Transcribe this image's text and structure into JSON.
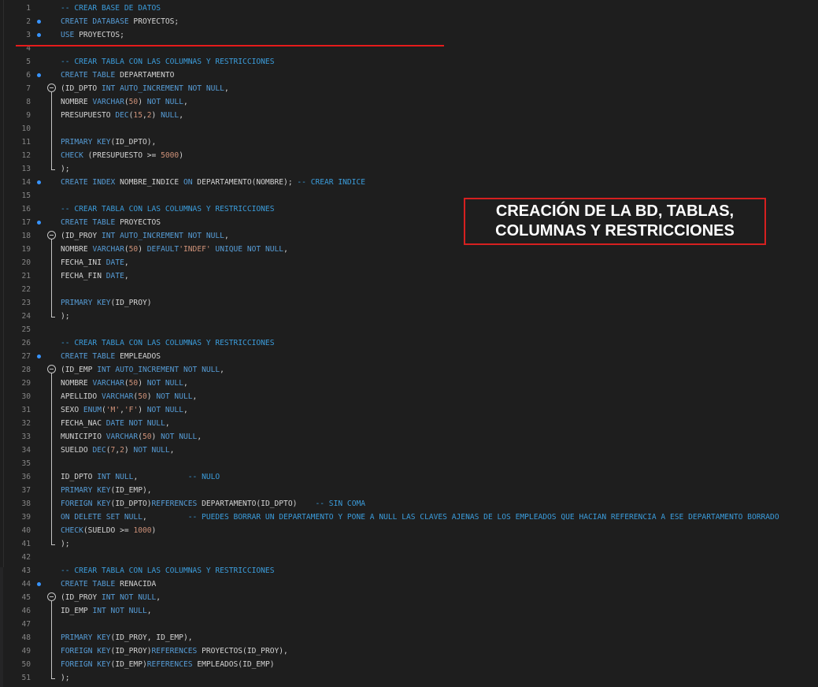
{
  "annotation": {
    "text": "CREACIÓN DE LA BD, TABLAS,\nCOLUMNAS Y RESTRICCIONES",
    "border_color": "#d62020",
    "text_color": "#ffffff"
  },
  "underline": {
    "color": "#e51b1b",
    "below_line": 3
  },
  "theme": {
    "background": "#1e1e1e",
    "keyword": "#569cd6",
    "identifier": "#d4d4d4",
    "number": "#ce9178",
    "comment": "#3b9cdb",
    "line_number": "#858585",
    "marker": "#3794ff"
  },
  "editor": {
    "lines": [
      {
        "n": "1",
        "tokens": [
          {
            "t": "com",
            "v": "-- CREAR BASE DE DATOS"
          }
        ]
      },
      {
        "n": "2",
        "marker": true,
        "tokens": [
          {
            "t": "kw",
            "v": "CREATE DATABASE "
          },
          {
            "t": "id",
            "v": "PROYECTOS;"
          }
        ]
      },
      {
        "n": "3",
        "marker": true,
        "tokens": [
          {
            "t": "kw",
            "v": "USE "
          },
          {
            "t": "id",
            "v": "PROYECTOS;"
          }
        ]
      },
      {
        "n": "4",
        "tokens": []
      },
      {
        "n": "5",
        "tokens": [
          {
            "t": "com",
            "v": "-- CREAR TABLA CON LAS COLUMNAS Y RESTRICCIONES"
          }
        ]
      },
      {
        "n": "6",
        "marker": true,
        "tokens": [
          {
            "t": "kw",
            "v": "CREATE TABLE "
          },
          {
            "t": "id",
            "v": "DEPARTAMENTO"
          }
        ]
      },
      {
        "n": "7",
        "fold": "start",
        "tokens": [
          {
            "t": "id",
            "v": "(ID_DPTO "
          },
          {
            "t": "kw",
            "v": "INT AUTO_INCREMENT NOT NULL"
          },
          {
            "t": "id",
            "v": ","
          }
        ]
      },
      {
        "n": "8",
        "fold": "mid",
        "tokens": [
          {
            "t": "id",
            "v": "NOMBRE "
          },
          {
            "t": "kw",
            "v": "VARCHAR"
          },
          {
            "t": "id",
            "v": "("
          },
          {
            "t": "num",
            "v": "50"
          },
          {
            "t": "id",
            "v": ") "
          },
          {
            "t": "kw",
            "v": "NOT NULL"
          },
          {
            "t": "id",
            "v": ","
          }
        ]
      },
      {
        "n": "9",
        "fold": "mid",
        "tokens": [
          {
            "t": "id",
            "v": "PRESUPUESTO "
          },
          {
            "t": "kw",
            "v": "DEC"
          },
          {
            "t": "id",
            "v": "("
          },
          {
            "t": "num",
            "v": "15"
          },
          {
            "t": "id",
            "v": ","
          },
          {
            "t": "num",
            "v": "2"
          },
          {
            "t": "id",
            "v": ") "
          },
          {
            "t": "kw",
            "v": "NULL"
          },
          {
            "t": "id",
            "v": ","
          }
        ]
      },
      {
        "n": "10",
        "fold": "mid",
        "tokens": []
      },
      {
        "n": "11",
        "fold": "mid",
        "tokens": [
          {
            "t": "kw",
            "v": "PRIMARY KEY"
          },
          {
            "t": "id",
            "v": "(ID_DPTO),"
          }
        ]
      },
      {
        "n": "12",
        "fold": "mid",
        "tokens": [
          {
            "t": "kw",
            "v": "CHECK "
          },
          {
            "t": "id",
            "v": "(PRESUPUESTO >= "
          },
          {
            "t": "num",
            "v": "5000"
          },
          {
            "t": "id",
            "v": ")"
          }
        ]
      },
      {
        "n": "13",
        "fold": "end",
        "tokens": [
          {
            "t": "id",
            "v": ");"
          }
        ]
      },
      {
        "n": "14",
        "marker": true,
        "tokens": [
          {
            "t": "kw",
            "v": "CREATE INDEX "
          },
          {
            "t": "id",
            "v": "NOMBRE_INDICE "
          },
          {
            "t": "kw",
            "v": "ON "
          },
          {
            "t": "id",
            "v": "DEPARTAMENTO(NOMBRE); "
          },
          {
            "t": "com",
            "v": "-- CREAR INDICE"
          }
        ]
      },
      {
        "n": "15",
        "tokens": []
      },
      {
        "n": "16",
        "tokens": [
          {
            "t": "com",
            "v": "-- CREAR TABLA CON LAS COLUMNAS Y RESTRICCIONES"
          }
        ]
      },
      {
        "n": "17",
        "marker": true,
        "tokens": [
          {
            "t": "kw",
            "v": "CREATE TABLE "
          },
          {
            "t": "id",
            "v": "PROYECTOS"
          }
        ]
      },
      {
        "n": "18",
        "fold": "start",
        "tokens": [
          {
            "t": "id",
            "v": "(ID_PROY "
          },
          {
            "t": "kw",
            "v": "INT AUTO_INCREMENT NOT NULL"
          },
          {
            "t": "id",
            "v": ","
          }
        ]
      },
      {
        "n": "19",
        "fold": "mid",
        "tokens": [
          {
            "t": "id",
            "v": "NOMBRE "
          },
          {
            "t": "kw",
            "v": "VARCHAR"
          },
          {
            "t": "id",
            "v": "("
          },
          {
            "t": "num",
            "v": "50"
          },
          {
            "t": "id",
            "v": ") "
          },
          {
            "t": "kw",
            "v": "DEFAULT"
          },
          {
            "t": "str",
            "v": "'INDEF'"
          },
          {
            "t": "kw",
            "v": " UNIQUE NOT NULL"
          },
          {
            "t": "id",
            "v": ","
          }
        ]
      },
      {
        "n": "20",
        "fold": "mid",
        "tokens": [
          {
            "t": "id",
            "v": "FECHA_INI "
          },
          {
            "t": "kw",
            "v": "DATE"
          },
          {
            "t": "id",
            "v": ","
          }
        ]
      },
      {
        "n": "21",
        "fold": "mid",
        "tokens": [
          {
            "t": "id",
            "v": "FECHA_FIN "
          },
          {
            "t": "kw",
            "v": "DATE"
          },
          {
            "t": "id",
            "v": ","
          }
        ]
      },
      {
        "n": "22",
        "fold": "mid",
        "tokens": []
      },
      {
        "n": "23",
        "fold": "mid",
        "tokens": [
          {
            "t": "kw",
            "v": "PRIMARY KEY"
          },
          {
            "t": "id",
            "v": "(ID_PROY)"
          }
        ]
      },
      {
        "n": "24",
        "fold": "end",
        "tokens": [
          {
            "t": "id",
            "v": ");"
          }
        ]
      },
      {
        "n": "25",
        "tokens": []
      },
      {
        "n": "26",
        "tokens": [
          {
            "t": "com",
            "v": "-- CREAR TABLA CON LAS COLUMNAS Y RESTRICCIONES"
          }
        ]
      },
      {
        "n": "27",
        "marker": true,
        "tokens": [
          {
            "t": "kw",
            "v": "CREATE TABLE "
          },
          {
            "t": "id",
            "v": "EMPLEADOS"
          }
        ]
      },
      {
        "n": "28",
        "fold": "start",
        "tokens": [
          {
            "t": "id",
            "v": "(ID_EMP "
          },
          {
            "t": "kw",
            "v": "INT AUTO_INCREMENT NOT NULL"
          },
          {
            "t": "id",
            "v": ","
          }
        ]
      },
      {
        "n": "29",
        "fold": "mid",
        "tokens": [
          {
            "t": "id",
            "v": "NOMBRE "
          },
          {
            "t": "kw",
            "v": "VARCHAR"
          },
          {
            "t": "id",
            "v": "("
          },
          {
            "t": "num",
            "v": "50"
          },
          {
            "t": "id",
            "v": ") "
          },
          {
            "t": "kw",
            "v": "NOT NULL"
          },
          {
            "t": "id",
            "v": ","
          }
        ]
      },
      {
        "n": "30",
        "fold": "mid",
        "tokens": [
          {
            "t": "id",
            "v": "APELLIDO "
          },
          {
            "t": "kw",
            "v": "VARCHAR"
          },
          {
            "t": "id",
            "v": "("
          },
          {
            "t": "num",
            "v": "50"
          },
          {
            "t": "id",
            "v": ") "
          },
          {
            "t": "kw",
            "v": "NOT NULL"
          },
          {
            "t": "id",
            "v": ","
          }
        ]
      },
      {
        "n": "31",
        "fold": "mid",
        "tokens": [
          {
            "t": "id",
            "v": "SEXO "
          },
          {
            "t": "kw",
            "v": "ENUM"
          },
          {
            "t": "id",
            "v": "("
          },
          {
            "t": "str",
            "v": "'M'"
          },
          {
            "t": "id",
            "v": ","
          },
          {
            "t": "str",
            "v": "'F'"
          },
          {
            "t": "id",
            "v": ") "
          },
          {
            "t": "kw",
            "v": "NOT NULL"
          },
          {
            "t": "id",
            "v": ","
          }
        ]
      },
      {
        "n": "32",
        "fold": "mid",
        "tokens": [
          {
            "t": "id",
            "v": "FECHA_NAC "
          },
          {
            "t": "kw",
            "v": "DATE NOT NULL"
          },
          {
            "t": "id",
            "v": ","
          }
        ]
      },
      {
        "n": "33",
        "fold": "mid",
        "tokens": [
          {
            "t": "id",
            "v": "MUNICIPIO "
          },
          {
            "t": "kw",
            "v": "VARCHAR"
          },
          {
            "t": "id",
            "v": "("
          },
          {
            "t": "num",
            "v": "50"
          },
          {
            "t": "id",
            "v": ") "
          },
          {
            "t": "kw",
            "v": "NOT NULL"
          },
          {
            "t": "id",
            "v": ","
          }
        ]
      },
      {
        "n": "34",
        "fold": "mid",
        "tokens": [
          {
            "t": "id",
            "v": "SUELDO "
          },
          {
            "t": "kw",
            "v": "DEC"
          },
          {
            "t": "id",
            "v": "("
          },
          {
            "t": "num",
            "v": "7"
          },
          {
            "t": "id",
            "v": ","
          },
          {
            "t": "num",
            "v": "2"
          },
          {
            "t": "id",
            "v": ") "
          },
          {
            "t": "kw",
            "v": "NOT NULL"
          },
          {
            "t": "id",
            "v": ","
          }
        ]
      },
      {
        "n": "35",
        "fold": "mid",
        "tokens": []
      },
      {
        "n": "36",
        "fold": "mid",
        "tokens": [
          {
            "t": "id",
            "v": "ID_DPTO "
          },
          {
            "t": "kw",
            "v": "INT NULL"
          },
          {
            "t": "id",
            "v": ",           "
          },
          {
            "t": "com",
            "v": "-- NULO"
          }
        ]
      },
      {
        "n": "37",
        "fold": "mid",
        "tokens": [
          {
            "t": "kw",
            "v": "PRIMARY KEY"
          },
          {
            "t": "id",
            "v": "(ID_EMP),"
          }
        ]
      },
      {
        "n": "38",
        "fold": "mid",
        "tokens": [
          {
            "t": "kw",
            "v": "FOREIGN KEY"
          },
          {
            "t": "id",
            "v": "(ID_DPTO)"
          },
          {
            "t": "kw",
            "v": "REFERENCES "
          },
          {
            "t": "id",
            "v": "DEPARTAMENTO(ID_DPTO)    "
          },
          {
            "t": "com",
            "v": "-- SIN COMA"
          }
        ]
      },
      {
        "n": "39",
        "fold": "mid",
        "tokens": [
          {
            "t": "kw",
            "v": "ON DELETE SET NULL"
          },
          {
            "t": "id",
            "v": ",         "
          },
          {
            "t": "com",
            "v": "-- PUEDES BORRAR UN DEPARTAMENTO Y PONE A NULL LAS CLAVES AJENAS DE LOS EMPLEADOS QUE HACIAN REFERENCIA A ESE DEPARTAMENTO BORRADO"
          }
        ]
      },
      {
        "n": "40",
        "fold": "mid",
        "tokens": [
          {
            "t": "kw",
            "v": "CHECK"
          },
          {
            "t": "id",
            "v": "(SUELDO >= "
          },
          {
            "t": "num",
            "v": "1000"
          },
          {
            "t": "id",
            "v": ")"
          }
        ]
      },
      {
        "n": "41",
        "fold": "end",
        "tokens": [
          {
            "t": "id",
            "v": ");"
          }
        ]
      },
      {
        "n": "42",
        "tokens": []
      },
      {
        "n": "43",
        "tokens": [
          {
            "t": "com",
            "v": "-- CREAR TABLA CON LAS COLUMNAS Y RESTRICCIONES"
          }
        ]
      },
      {
        "n": "44",
        "marker": true,
        "tokens": [
          {
            "t": "kw",
            "v": "CREATE TABLE "
          },
          {
            "t": "id",
            "v": "RENACIDA"
          }
        ]
      },
      {
        "n": "45",
        "fold": "start",
        "tokens": [
          {
            "t": "id",
            "v": "(ID_PROY "
          },
          {
            "t": "kw",
            "v": "INT NOT NULL"
          },
          {
            "t": "id",
            "v": ","
          }
        ]
      },
      {
        "n": "46",
        "fold": "mid",
        "tokens": [
          {
            "t": "id",
            "v": "ID_EMP "
          },
          {
            "t": "kw",
            "v": "INT NOT NULL"
          },
          {
            "t": "id",
            "v": ","
          }
        ]
      },
      {
        "n": "47",
        "fold": "mid",
        "tokens": []
      },
      {
        "n": "48",
        "fold": "mid",
        "tokens": [
          {
            "t": "kw",
            "v": "PRIMARY KEY"
          },
          {
            "t": "id",
            "v": "(ID_PROY, ID_EMP),"
          }
        ]
      },
      {
        "n": "49",
        "fold": "mid",
        "tokens": [
          {
            "t": "kw",
            "v": "FOREIGN KEY"
          },
          {
            "t": "id",
            "v": "(ID_PROY)"
          },
          {
            "t": "kw",
            "v": "REFERENCES "
          },
          {
            "t": "id",
            "v": "PROYECTOS(ID_PROY),"
          }
        ]
      },
      {
        "n": "50",
        "fold": "mid",
        "tokens": [
          {
            "t": "kw",
            "v": "FOREIGN KEY"
          },
          {
            "t": "id",
            "v": "(ID_EMP)"
          },
          {
            "t": "kw",
            "v": "REFERENCES "
          },
          {
            "t": "id",
            "v": "EMPLEADOS(ID_EMP)"
          }
        ]
      },
      {
        "n": "51",
        "fold": "end",
        "tokens": [
          {
            "t": "id",
            "v": ");"
          }
        ]
      }
    ]
  }
}
